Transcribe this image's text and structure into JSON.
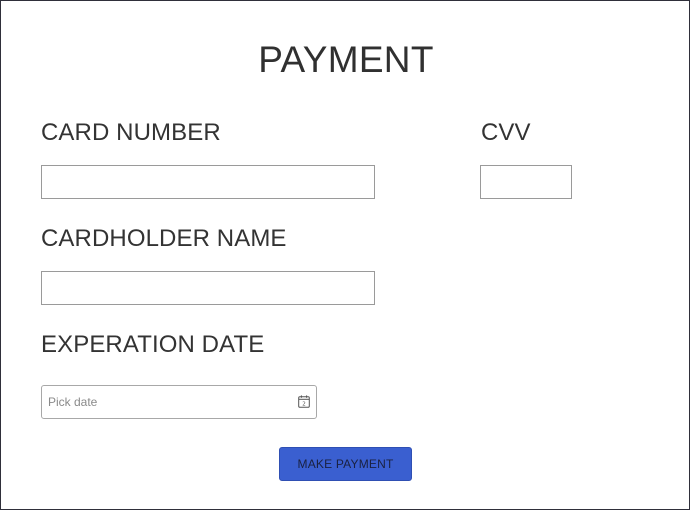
{
  "form": {
    "title": "PAYMENT",
    "card_number": {
      "label": "CARD NUMBER",
      "value": ""
    },
    "cvv": {
      "label": "CVV",
      "value": ""
    },
    "cardholder_name": {
      "label": "CARDHOLDER NAME",
      "value": ""
    },
    "expiration_date": {
      "label": "EXPERATION DATE",
      "placeholder": "Pick date",
      "icon": "calendar-icon"
    },
    "submit_label": "MAKE PAYMENT"
  },
  "colors": {
    "button_bg": "#3a5fd0",
    "frame_border": "#2f2f3a",
    "text": "#333333"
  }
}
